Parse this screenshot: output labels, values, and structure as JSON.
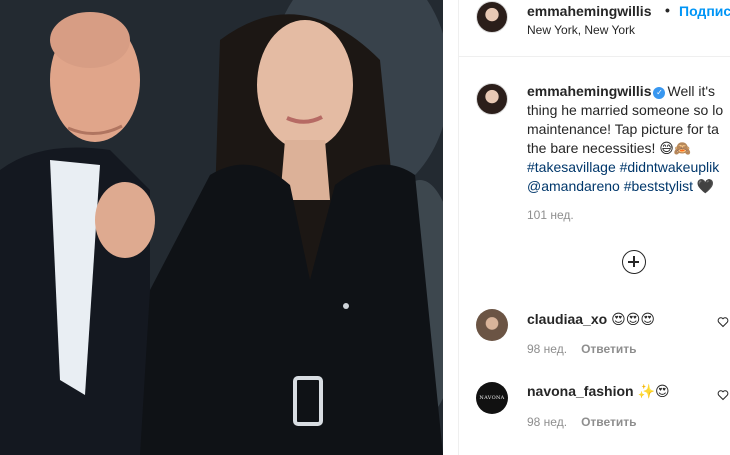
{
  "post": {
    "username": "emmahemingwillis",
    "separator": "•",
    "follow_label": "Подписа",
    "location": "New York, New York"
  },
  "caption": {
    "username": "emmahemingwillis",
    "line1_text": "Well it's",
    "line2": "thing he married someone so lo",
    "line3": "maintenance! Tap picture for ta",
    "line4": "the bare necessities! 😅🙈",
    "line5_tags": "#takesavillage #didntwakeuplik",
    "line6_tags": "@amandareno #beststylist",
    "line6_emoji": "🖤",
    "time": "101 нед."
  },
  "comments": [
    {
      "username": "claudiaa_xo",
      "emojis": "😍😍😍",
      "time": "98 нед.",
      "reply_label": "Ответить"
    },
    {
      "username": "navona_fashion",
      "emojis": "✨😍",
      "time": "98 нед.",
      "reply_label": "Ответить",
      "avatar_text": "NAVONA"
    }
  ],
  "colors": {
    "accent": "#0095f6",
    "verified": "#3897f0",
    "hashtag": "#00376b",
    "muted": "#8e8e8e"
  },
  "icons": [
    "verified-badge-icon",
    "plus-circle-icon",
    "heart-icon"
  ]
}
